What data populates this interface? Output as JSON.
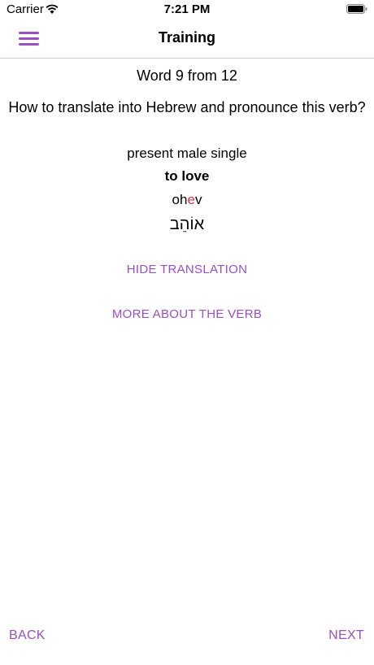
{
  "status_bar": {
    "carrier": "Carrier",
    "time": "7:21 PM"
  },
  "nav": {
    "title": "Training",
    "menu_icon": "hamburger-menu-icon"
  },
  "card": {
    "progress": "Word 9 from 12",
    "question": "How to translate into Hebrew and pronounce this verb?",
    "form": "present male single",
    "meaning": "to love",
    "pronunciation_before": "oh",
    "pronunciation_stress": "e",
    "pronunciation_after": "v",
    "hebrew": "אוֹהֵב"
  },
  "actions": {
    "hide_translation": "HIDE TRANSLATION",
    "more_about": "MORE ABOUT THE VERB",
    "back": "BACK",
    "next": "NEXT"
  },
  "colors": {
    "accent": "#9a4fc4",
    "stress": "#e0304a"
  }
}
